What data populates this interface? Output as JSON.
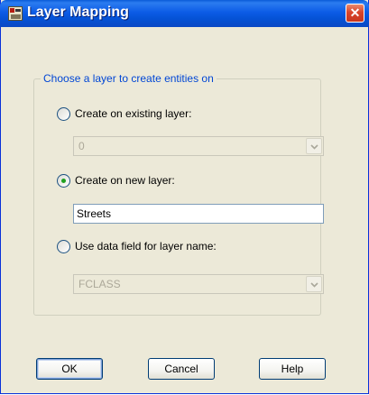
{
  "window": {
    "title": "Layer Mapping",
    "close_glyph": "✕",
    "app_icon": "app-icon"
  },
  "group": {
    "legend": "Choose a layer to create entities on"
  },
  "options": {
    "existing": {
      "label": "Create on existing layer:",
      "selected": false
    },
    "new": {
      "label": "Create on new layer:",
      "selected": true
    },
    "field": {
      "label": "Use data field for layer name:",
      "selected": false
    }
  },
  "existing_layer_combo": {
    "value": "0",
    "enabled": false
  },
  "new_layer_input": {
    "value": "Streets"
  },
  "field_combo": {
    "value": "FCLASS",
    "enabled": false
  },
  "buttons": {
    "ok": "OK",
    "cancel": "Cancel",
    "help": "Help"
  },
  "colors": {
    "titlebar": "#0a5bd8",
    "legend": "#0046d5",
    "radio_dot": "#21a121",
    "dialog_bg": "#ece9d8"
  }
}
